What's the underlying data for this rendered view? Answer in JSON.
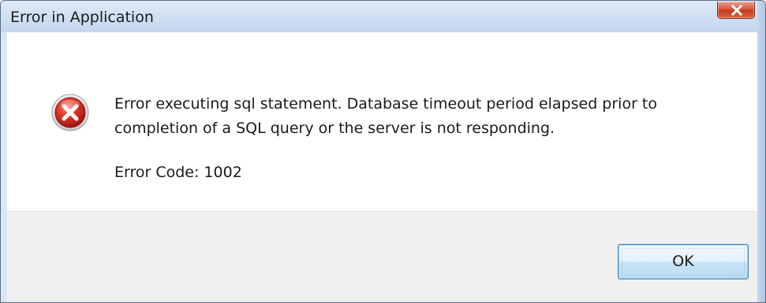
{
  "window": {
    "title": "Error in Application"
  },
  "dialog": {
    "icon": "error-icon",
    "message_lines": [
      "Error executing sql statement. Database timeout period elapsed prior to",
      "completion of a SQL query or the server is not responding."
    ],
    "error_code": "Error Code: 1002"
  },
  "buttons": {
    "ok_label": "OK",
    "close_icon": "close-icon"
  },
  "colors": {
    "close_button": "#d9563e",
    "error_icon": "#c0271f",
    "titlebar": "#cfdff1"
  }
}
